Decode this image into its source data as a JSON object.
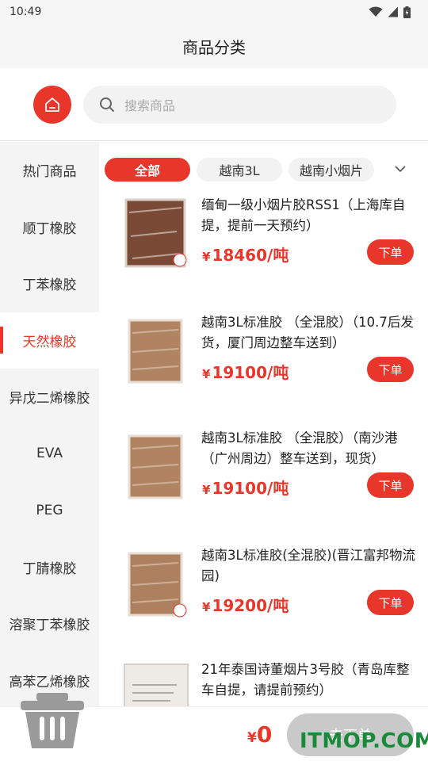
{
  "status_bar": {
    "time": "10:49"
  },
  "header": {
    "title": "商品分类"
  },
  "search": {
    "placeholder": "搜索商品"
  },
  "sidebar": {
    "items": [
      {
        "label": "热门商品",
        "active": false
      },
      {
        "label": "顺丁橡胶",
        "active": false
      },
      {
        "label": "丁苯橡胶",
        "active": false
      },
      {
        "label": "天然橡胶",
        "active": true
      },
      {
        "label": "异戊二烯橡胶",
        "active": false
      },
      {
        "label": "EVA",
        "active": false
      },
      {
        "label": "PEG",
        "active": false
      },
      {
        "label": "丁腈橡胶",
        "active": false
      },
      {
        "label": "溶聚丁苯橡胶",
        "active": false
      },
      {
        "label": "高苯乙烯橡胶",
        "active": false
      }
    ]
  },
  "filters": {
    "chips": [
      {
        "label": "全部",
        "active": true
      },
      {
        "label": "越南3L",
        "active": false
      },
      {
        "label": "越南小烟片",
        "active": false
      }
    ]
  },
  "products": [
    {
      "name": "缅甸一级小烟片胶RSS1（上海库自提，提前一天预约）",
      "price": "18460/吨",
      "currency": "¥",
      "order_label": "下单"
    },
    {
      "name": "越南3L标准胶 （全混胶）（10.7后发货，厦门周边整车送到）",
      "price": "19100/吨",
      "currency": "¥",
      "order_label": "下单"
    },
    {
      "name": "越南3L标准胶 （全混胶）（南沙港（广州周边）整车送到，现货）",
      "price": "19100/吨",
      "currency": "¥",
      "order_label": "下单"
    },
    {
      "name": "越南3L标准胶(全混胶)(晋江富邦物流园)",
      "price": "19200/吨",
      "currency": "¥",
      "order_label": "下单"
    },
    {
      "name": "21年泰国诗董烟片3号胶（青岛库整车自提，请提前预约）",
      "price": "",
      "currency": "",
      "order_label": ""
    }
  ],
  "bottom_bar": {
    "currency": "¥",
    "total": "0",
    "submit_label": "去下单",
    "watermark": "ITMOP.COM"
  },
  "colors": {
    "accent": "#e8362b",
    "sidebar_bg": "#f4f4f4",
    "disabled": "#c9c9c9"
  }
}
